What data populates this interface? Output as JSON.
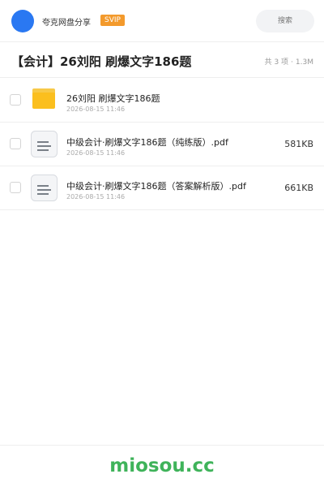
{
  "header": {
    "app_title": "夸克网盘分享",
    "svip_badge": "SVIP",
    "search_placeholder": "搜索",
    "avatar_color": "#2a78f2",
    "badge_color": "#f39a2c"
  },
  "share": {
    "title": "【会计】26刘阳 刷爆文字186题",
    "item_count": "共 3 项",
    "separator": "·",
    "total_size": "1.3M"
  },
  "files": [
    {
      "name": "26刘阳 刷爆文字186题",
      "date": "2026-08-15 11:46",
      "size": "",
      "icon": "folder-icon"
    },
    {
      "name": "中级会计·刷爆文字186题（纯练版）.pdf",
      "date": "2026-08-15 11:46",
      "size": "581KB",
      "icon": "document-icon"
    },
    {
      "name": "中级会计·刷爆文字186题（答案解析版）.pdf",
      "date": "2026-08-15 11:46",
      "size": "661KB",
      "icon": "document-icon"
    }
  ],
  "footer": {
    "site_logo": "miosou.cc",
    "logo_color": "#3fb35a"
  }
}
